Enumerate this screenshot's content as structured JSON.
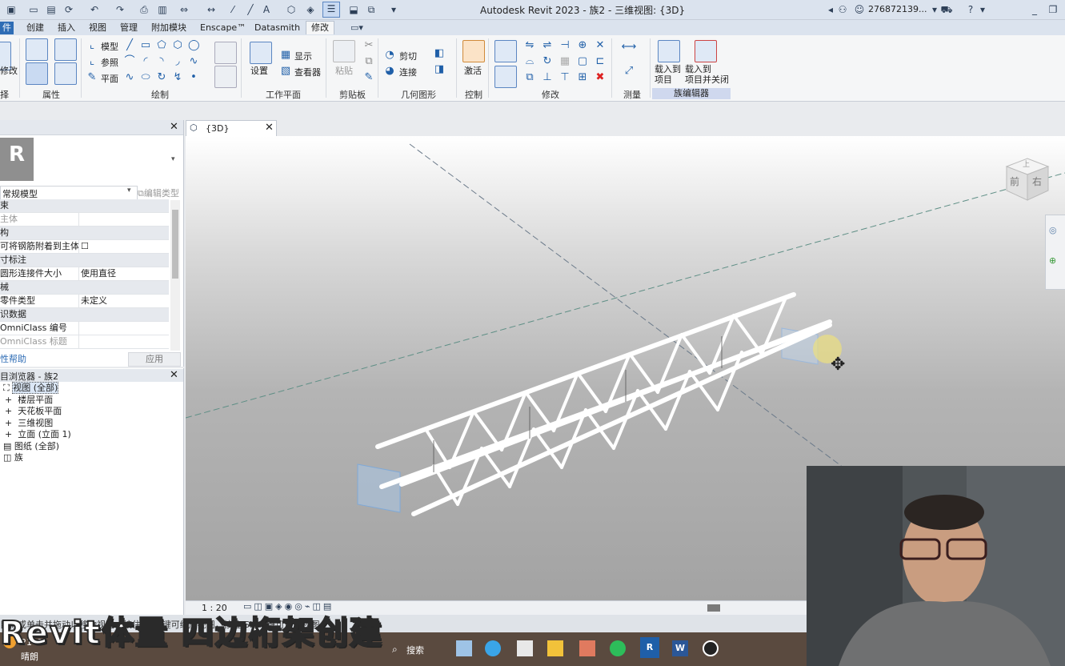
{
  "title_bar": {
    "app_title": "Autodesk Revit 2023 - 族2 - 三维视图: {3D}",
    "user": "276872139..."
  },
  "menu": {
    "tabs": [
      "件",
      "创建",
      "插入",
      "视图",
      "管理",
      "附加模块",
      "Enscape™",
      "Datasmith",
      "修改"
    ]
  },
  "ribbon": {
    "modify_label": "修改",
    "select_label": "择",
    "properties_label": "属性",
    "draw": {
      "model": "模型",
      "reference": "参照",
      "plane": "平面",
      "label": "绘制"
    },
    "workplane": {
      "set": "设置",
      "show": "显示",
      "viewer": "查看器",
      "label": "工作平面"
    },
    "clipboard": {
      "paste": "粘贴",
      "label": "剪贴板"
    },
    "geometry": {
      "cut": "剪切",
      "join": "连接",
      "label": "几何图形"
    },
    "control": {
      "activate": "激活",
      "label": "控制"
    },
    "modify_panel_label": "修改",
    "measure_label": "测量",
    "family_editor": {
      "load_into_project": "载入到\n项目",
      "load_and_close": "载入到\n项目并关闭",
      "label": "族编辑器"
    }
  },
  "properties": {
    "type_name": "常规模型",
    "edit_type": "编辑类型",
    "rows": [
      {
        "label": "束",
        "value": "",
        "group": true
      },
      {
        "label": "主体",
        "value": "",
        "group": false
      },
      {
        "label": "构",
        "value": "",
        "group": true
      },
      {
        "label": "可将钢筋附着到主体",
        "value": "☐",
        "group": false
      },
      {
        "label": "寸标注",
        "value": "",
        "group": true
      },
      {
        "label": "圆形连接件大小",
        "value": "使用直径",
        "group": false
      },
      {
        "label": "械",
        "value": "",
        "group": true
      },
      {
        "label": "零件类型",
        "value": "未定义",
        "group": false
      },
      {
        "label": "识数据",
        "value": "",
        "group": true
      },
      {
        "label": "OmniClass 编号",
        "value": "",
        "group": false
      },
      {
        "label": "OmniClass 标题",
        "value": "",
        "group": false
      }
    ],
    "help": "性帮助",
    "apply": "应用"
  },
  "browser": {
    "title": "目浏览器 - 族2",
    "items": [
      {
        "label": "视图 (全部)",
        "level": 0
      },
      {
        "label": "楼层平面",
        "level": 1
      },
      {
        "label": "天花板平面",
        "level": 1
      },
      {
        "label": "三维视图",
        "level": 1
      },
      {
        "label": "立面 (立面 1)",
        "level": 1
      },
      {
        "label": "图纸 (全部)",
        "level": 0
      },
      {
        "label": "族",
        "level": 0
      }
    ]
  },
  "view_tab": {
    "label": "{3D}"
  },
  "viewcube": {
    "front": "前",
    "right": "右",
    "top": "上"
  },
  "view_bar": {
    "scale": "1 : 20"
  },
  "status_bar": {
    "text": "目标或单击并拖动以移动视图，按住 Ctrl 键可缩放视图，按住 Shift 键可旋转视图。"
  },
  "taskbar": {
    "weather_temp": "21°C",
    "weather_text": "晴朗",
    "search": "搜索"
  },
  "watermark": "Revit体量 四边桁架创建"
}
